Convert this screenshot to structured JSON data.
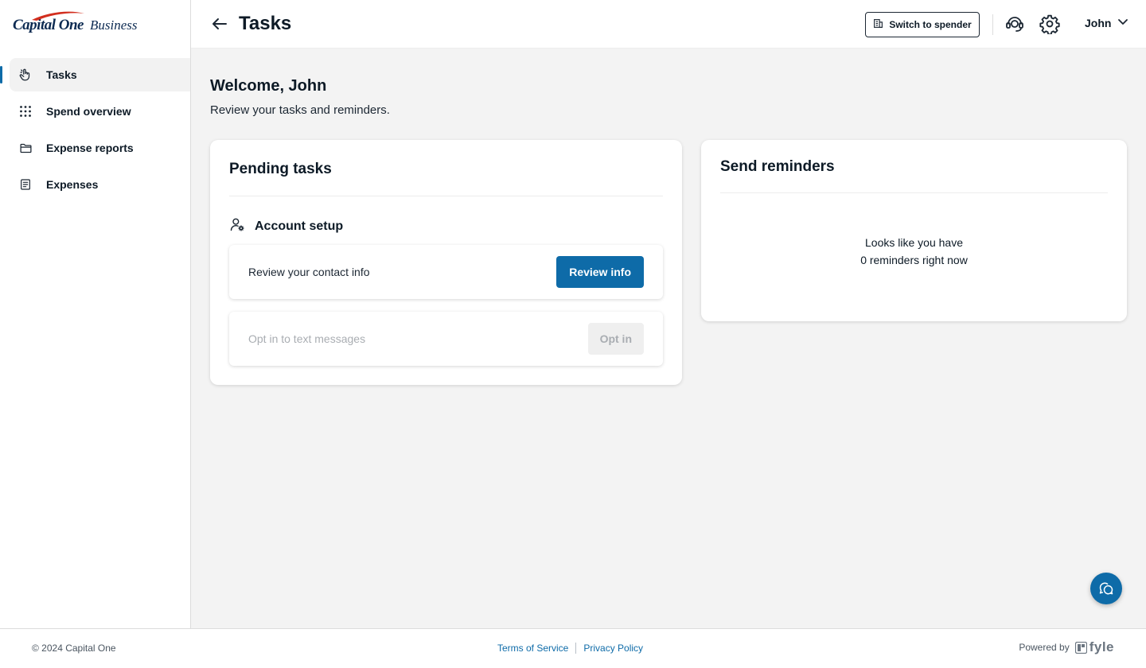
{
  "brand": {
    "name": "Capital One",
    "product": "Business",
    "accent_color": "#0e6ba8",
    "logo_red": "#d22e1e"
  },
  "sidebar": {
    "items": [
      {
        "label": "Tasks",
        "icon": "hand-pointer-icon",
        "active": true
      },
      {
        "label": "Spend overview",
        "icon": "grid-dots-icon",
        "active": false
      },
      {
        "label": "Expense reports",
        "icon": "folder-icon",
        "active": false
      },
      {
        "label": "Expenses",
        "icon": "receipt-icon",
        "active": false
      }
    ]
  },
  "header": {
    "title": "Tasks",
    "switch_label": "Switch to spender",
    "user_name": "John",
    "icons": [
      "back-arrow-icon",
      "building-icon",
      "support-headset-icon",
      "gear-icon",
      "chevron-down-icon"
    ]
  },
  "main": {
    "welcome": "Welcome, John",
    "subtitle": "Review your tasks and reminders.",
    "pending": {
      "title": "Pending tasks",
      "section": "Account setup",
      "section_icon": "user-gear-icon",
      "tasks": [
        {
          "label": "Review your contact info",
          "action": "Review info",
          "enabled": true
        },
        {
          "label": "Opt in to text messages",
          "action": "Opt in",
          "enabled": false
        }
      ]
    },
    "reminders": {
      "title": "Send reminders",
      "empty_line1": "Looks like you have",
      "empty_line2": "0 reminders right now"
    },
    "chat_icon": "chat-bubbles-icon"
  },
  "footer": {
    "copyright": "© 2024 Capital One",
    "terms": "Terms of Service",
    "privacy": "Privacy Policy",
    "powered_by": "Powered by",
    "powered_brand": "fyle"
  }
}
